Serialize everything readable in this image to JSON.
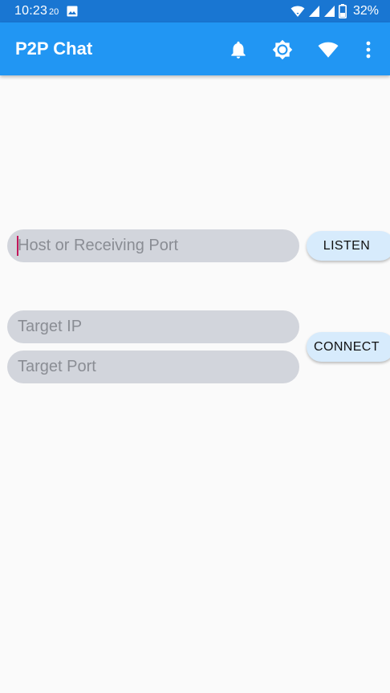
{
  "status_bar": {
    "time": "10:23",
    "seconds": "20",
    "battery": "32%",
    "icons": [
      "image-icon",
      "wifi-signal-icon",
      "cell-signal-icon",
      "cell-signal-icon",
      "battery-icon"
    ]
  },
  "app_bar": {
    "title": "P2P Chat",
    "actions": [
      "bell-icon",
      "brightness-icon",
      "wifi-icon",
      "more-vert-icon"
    ],
    "color": "#2196f3"
  },
  "listen": {
    "placeholder": "Host or Receiving Port",
    "value": "",
    "button_label": "LISTEN"
  },
  "connect": {
    "ip_placeholder": "Target IP",
    "port_placeholder": "Target Port",
    "ip_value": "",
    "port_value": "",
    "button_label": "CONNECT"
  },
  "colors": {
    "status_bar": "#1976d2",
    "input_bg": "#d2d5dc",
    "button_bg": "#d7ebfc",
    "cursor": "#c2185b"
  }
}
